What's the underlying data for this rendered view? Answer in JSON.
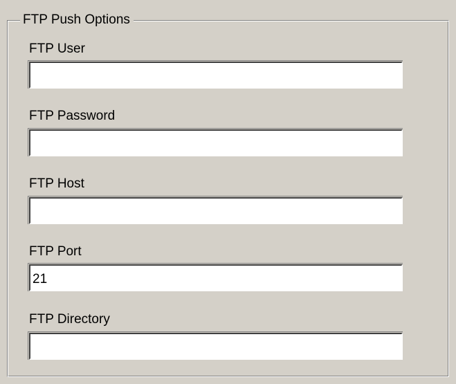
{
  "group": {
    "title": "FTP Push Options"
  },
  "fields": {
    "user": {
      "label": "FTP User",
      "value": ""
    },
    "password": {
      "label": "FTP Password",
      "value": ""
    },
    "host": {
      "label": "FTP Host",
      "value": ""
    },
    "port": {
      "label": "FTP Port",
      "value": "21"
    },
    "directory": {
      "label": "FTP Directory",
      "value": ""
    }
  }
}
